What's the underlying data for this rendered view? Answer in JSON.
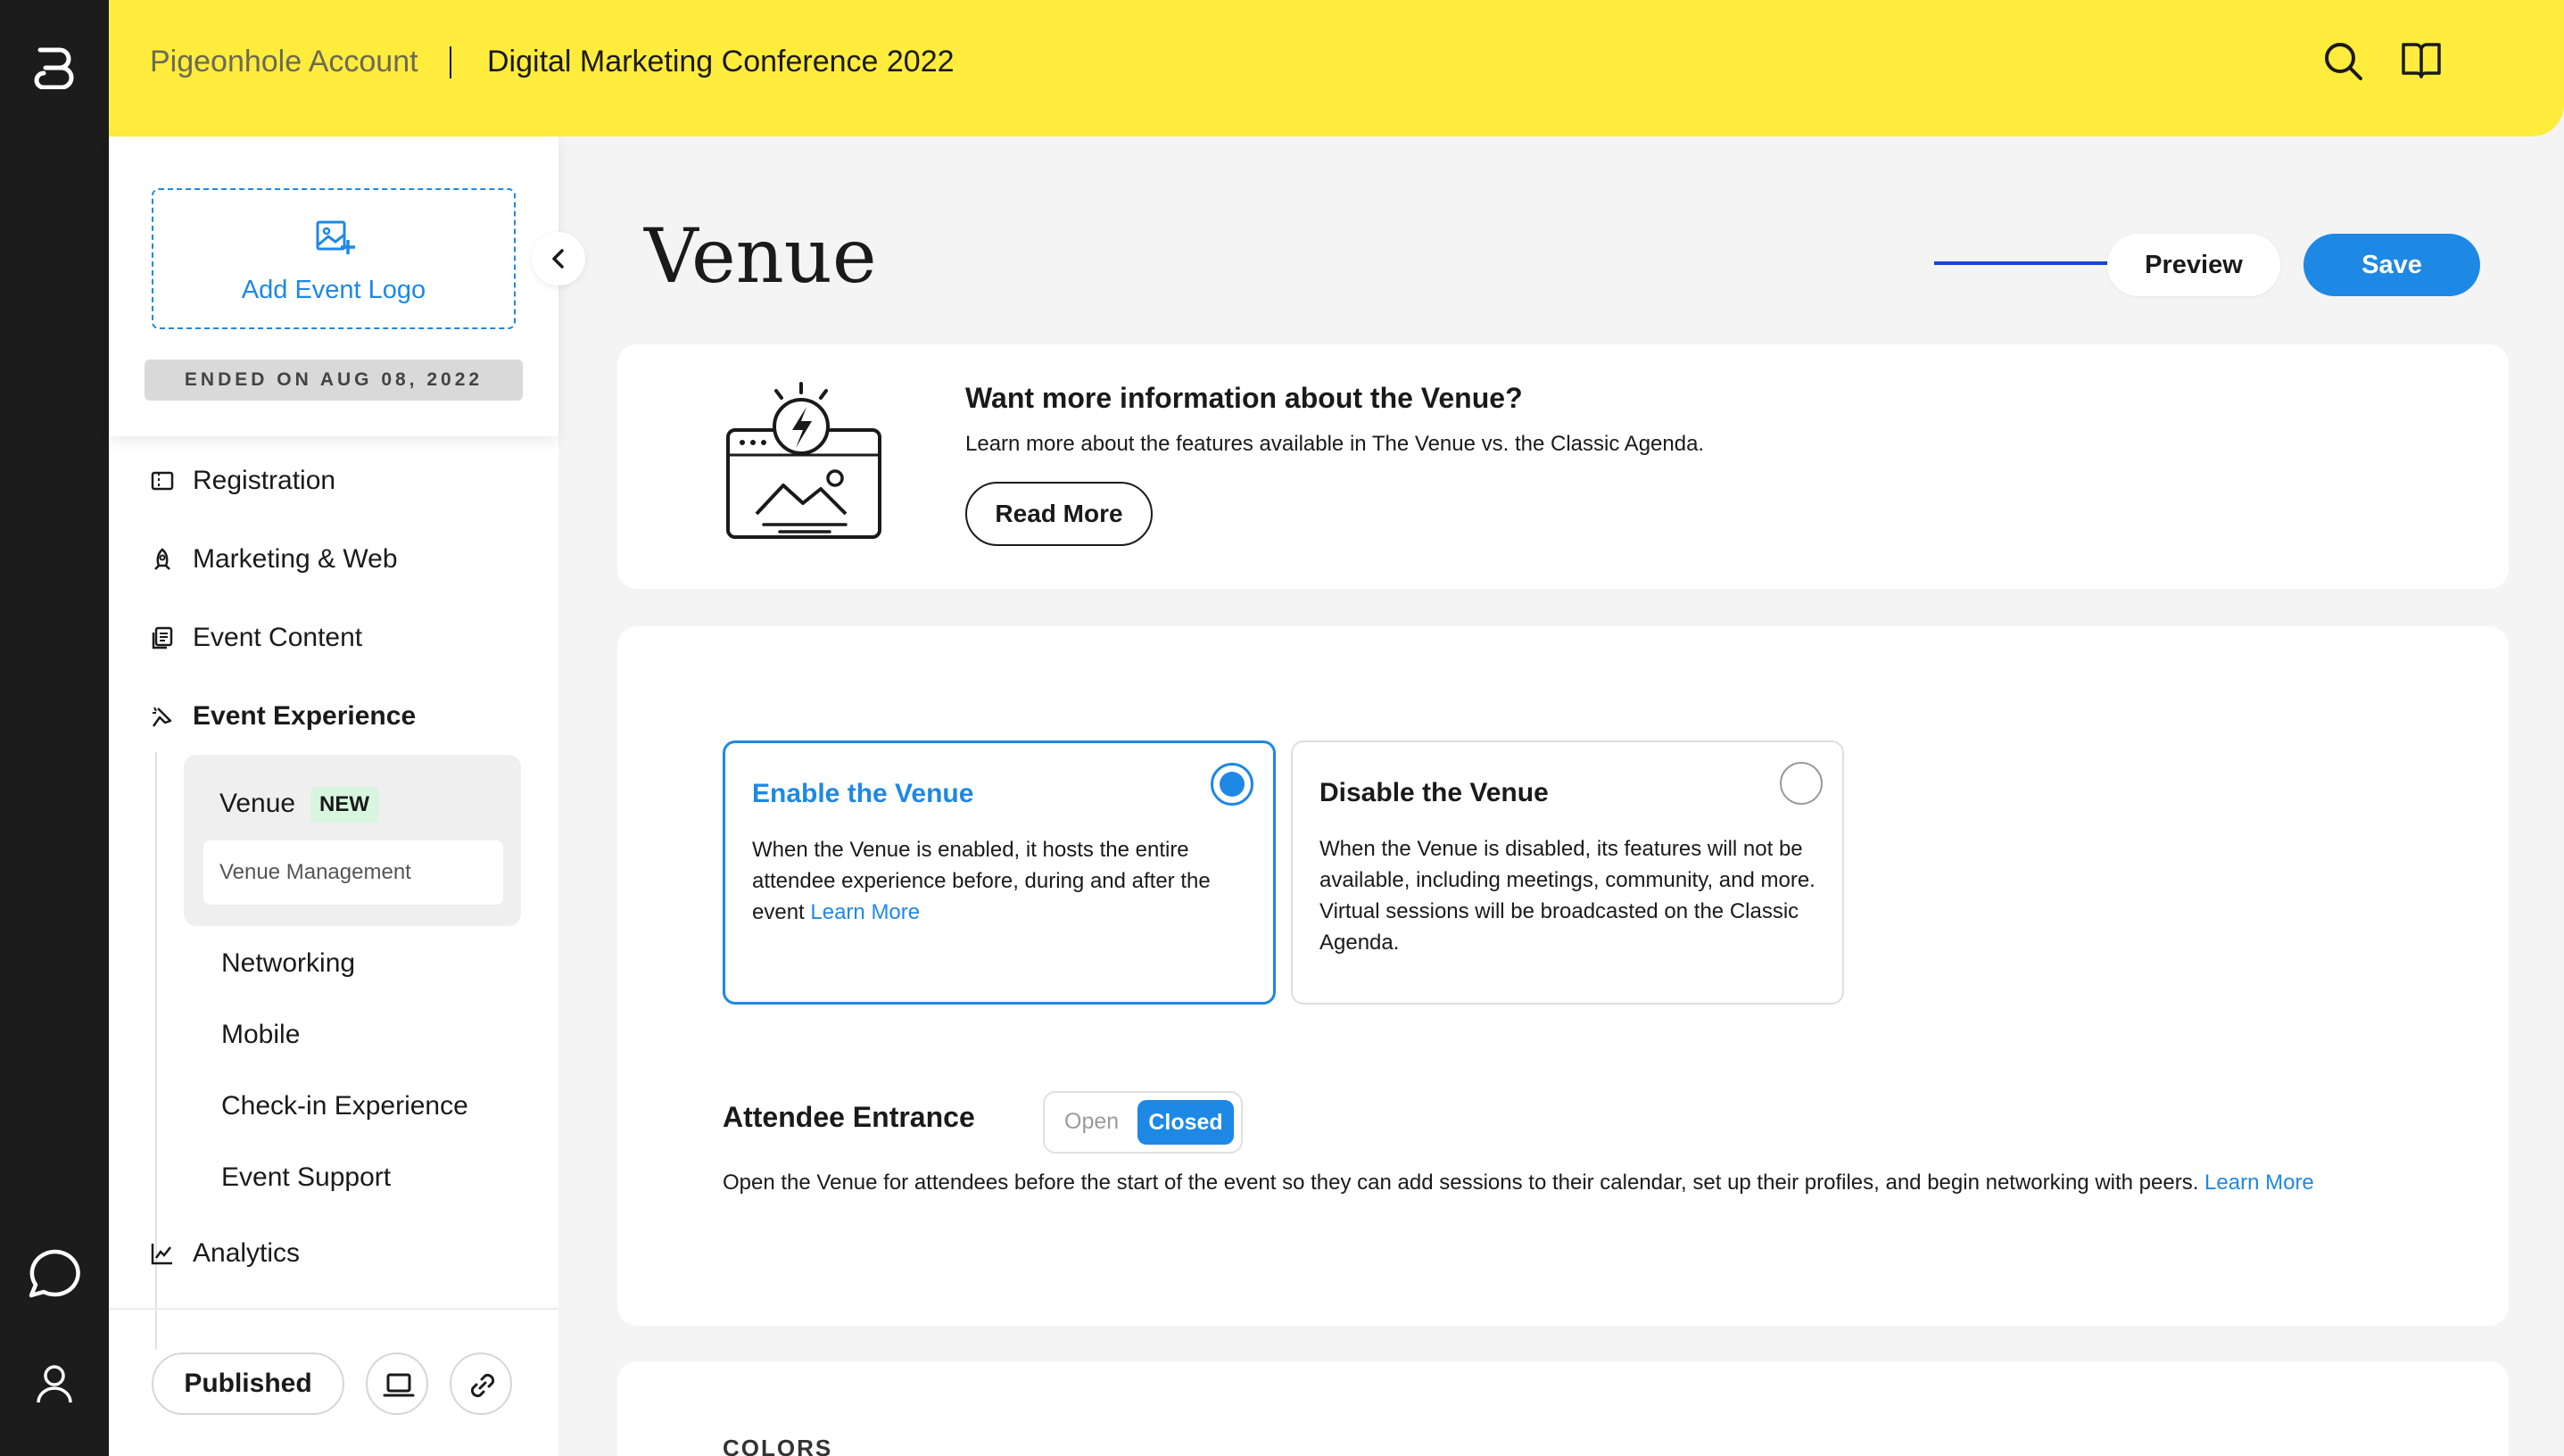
{
  "header": {
    "account": "Pigeonhole Account",
    "event_title": "Digital Marketing Conference 2022"
  },
  "sidebar": {
    "add_logo_label": "Add Event Logo",
    "ended_label": "ENDED ON AUG 08, 2022",
    "nav": {
      "registration": "Registration",
      "marketing": "Marketing & Web",
      "content": "Event Content",
      "experience": "Event Experience",
      "analytics": "Analytics"
    },
    "venue_label": "Venue",
    "new_badge": "NEW",
    "venue_management": "Venue Management",
    "sub_items": [
      "Networking",
      "Mobile",
      "Check-in Experience",
      "Event Support"
    ],
    "published_label": "Published"
  },
  "main": {
    "title": "Venue",
    "preview_label": "Preview",
    "save_label": "Save",
    "info": {
      "heading": "Want more information about the Venue?",
      "text": "Learn more about the features available in The Venue vs. the Classic Agenda.",
      "read_more": "Read More"
    },
    "enable": {
      "title": "Enable the Venue",
      "text": "When the Venue is enabled, it hosts the entire attendee experience before, during and after the event",
      "link": "Learn More"
    },
    "disable": {
      "title": "Disable the Venue",
      "text": "When the Venue is disabled, its features will not be available, including meetings, community, and more. Virtual sessions will be broadcasted on the Classic Agenda."
    },
    "entrance": {
      "label": "Attendee Entrance",
      "open": "Open",
      "closed": "Closed",
      "text": "Open the Venue for attendees before the start of the event so they can add sessions to their calendar, set up their profiles, and begin networking with peers.",
      "link": "Learn More"
    },
    "colors_label": "COLORS"
  },
  "colors": {
    "accent": "#1e88e5",
    "header_bg": "#ffec3d",
    "rail_bg": "#1c1c1c",
    "new_badge_bg": "#d8f5e0"
  }
}
